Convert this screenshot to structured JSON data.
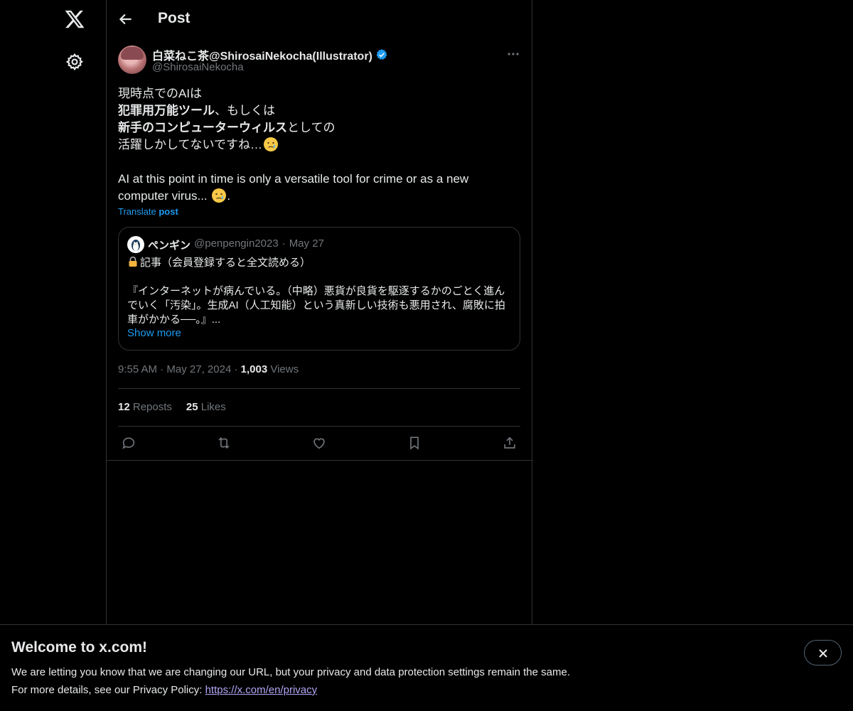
{
  "header": {
    "title": "Post"
  },
  "post": {
    "author_name": "白菜ねこ茶@ShirosaiNekocha(Illustrator)",
    "author_handle": "@ShirosaiNekocha",
    "text_ja": {
      "line1": "現時点でのAIは",
      "line2_bold": "犯罪用万能ツール",
      "line2_rest": "、もしくは",
      "line3_bold": "新手のコンピューターウィルス",
      "line3_rest": "としての",
      "line4": "活躍しかしてないですね…"
    },
    "text_en": {
      "line1": "AI at this point in time is only a versatile tool for crime or as a new",
      "line2": "computer virus...",
      "line2_end": "."
    },
    "translate_label": "Translate",
    "translate_bold": "post",
    "quote": {
      "name": "ペンギン",
      "handle": "@penpengin2023",
      "sep": "·",
      "date": "May 27",
      "line1": "記事（会員登録すると全文読める）",
      "line2": "",
      "line3": "『インターネットが病んでいる。（中略）悪貨が良貨を駆逐するかのごとく進ん",
      "line4": "でいく「汚染」。生成AI（人工知能）という真新しい技術も悪用され、腐敗に拍",
      "line5": "車がかかる──。』...",
      "show_more": "Show more"
    },
    "time": "9:55 AM",
    "sep": "·",
    "date": "May 27, 2024",
    "views_count": "1,003",
    "views_label": "Views",
    "reposts_count": "12",
    "reposts_label": "Reposts",
    "likes_count": "25",
    "likes_label": "Likes"
  },
  "banner": {
    "title": "Welcome to x.com!",
    "line1": "We are letting you know that we are changing our URL, but your privacy and data protection settings remain the same.",
    "line2_prefix": "For more details, see our Privacy Policy: ",
    "link": "https://x.com/en/privacy"
  },
  "colors": {
    "accent": "#1d9bf0",
    "muted": "#71767b",
    "border": "#2f3336",
    "link_banner": "#b4a6f5"
  },
  "icons": [
    "x-logo-icon",
    "gear-icon",
    "back-arrow-icon",
    "verified-badge-icon",
    "more-icon",
    "reply-icon",
    "repost-icon",
    "like-icon",
    "bookmark-icon",
    "share-icon",
    "close-icon",
    "lock-icon",
    "crying-face-icon"
  ]
}
